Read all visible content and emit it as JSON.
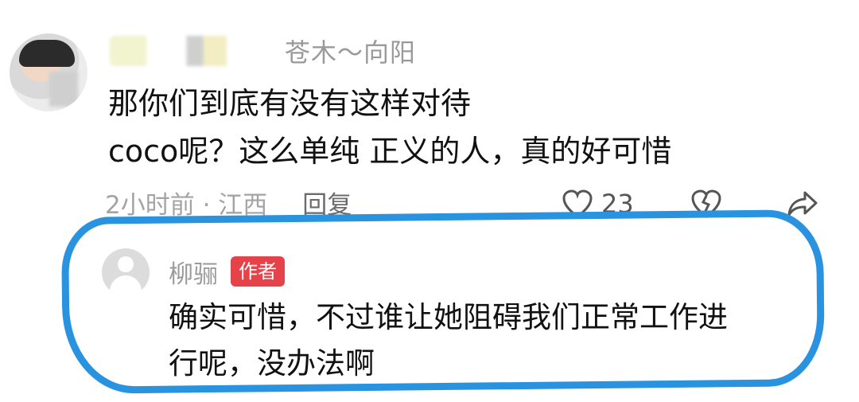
{
  "comment": {
    "username_visible": "苍木～向阳",
    "lines": [
      "那你们到底有没有这样对待",
      "coco呢？这么单纯 正义的人，真的好可惜"
    ],
    "meta": "2小时前 · 江西",
    "reply_label": "回复",
    "like_count": "23",
    "icons": [
      "heart-icon",
      "broken-heart-icon",
      "share-arrow-icon"
    ]
  },
  "reply": {
    "username": "柳骊",
    "badge": "作者",
    "lines": [
      "确实可惜，不过谁让她阻碍我们正常工作进",
      "行呢，没办法啊"
    ]
  },
  "colors": {
    "highlight_circle": "#2a93df",
    "author_badge": "#e5424a",
    "muted_text": "#a4a4a4"
  }
}
